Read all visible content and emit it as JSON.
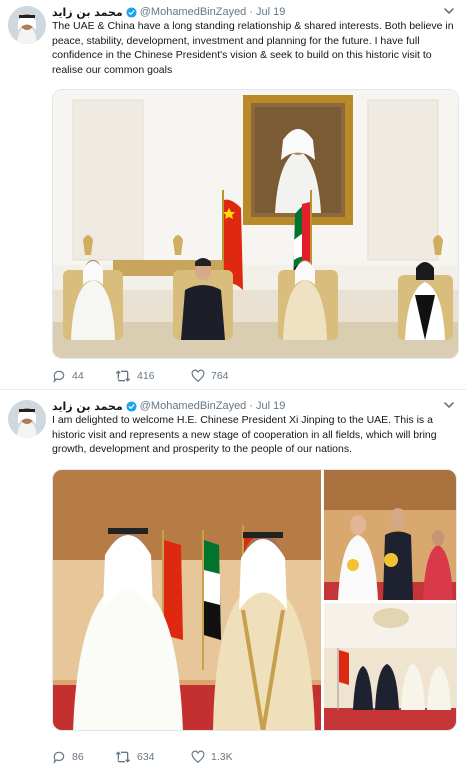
{
  "tweets": [
    {
      "name": "محمد بن زايد",
      "handle": "@MohamedBinZayed",
      "separator": "·",
      "time": "Jul 19",
      "text": "The UAE & China have a long standing relationship & shared interests. Both believe in peace, stability, development, investment and planning for the future. I have full confidence in the Chinese President's vision & seek to build on this historic visit to realise our common goals",
      "replies": "44",
      "retweets": "416",
      "likes": "764"
    },
    {
      "name": "محمد بن زايد",
      "handle": "@MohamedBinZayed",
      "separator": "·",
      "time": "Jul 19",
      "text": "I am delighted to welcome H.E. Chinese President Xi Jinping to the UAE. This is a historic visit and represents a new stage of cooperation in all fields, which will bring growth, development and prosperity to the people of our nations.",
      "replies": "86",
      "retweets": "634",
      "likes": "1.3K"
    }
  ],
  "colors": {
    "verified": "#1da1f2",
    "secondary_text": "#657786",
    "border": "#e6ecf0"
  },
  "icons": [
    "verified-badge-icon",
    "chevron-down-icon",
    "reply-icon",
    "retweet-icon",
    "like-icon"
  ]
}
